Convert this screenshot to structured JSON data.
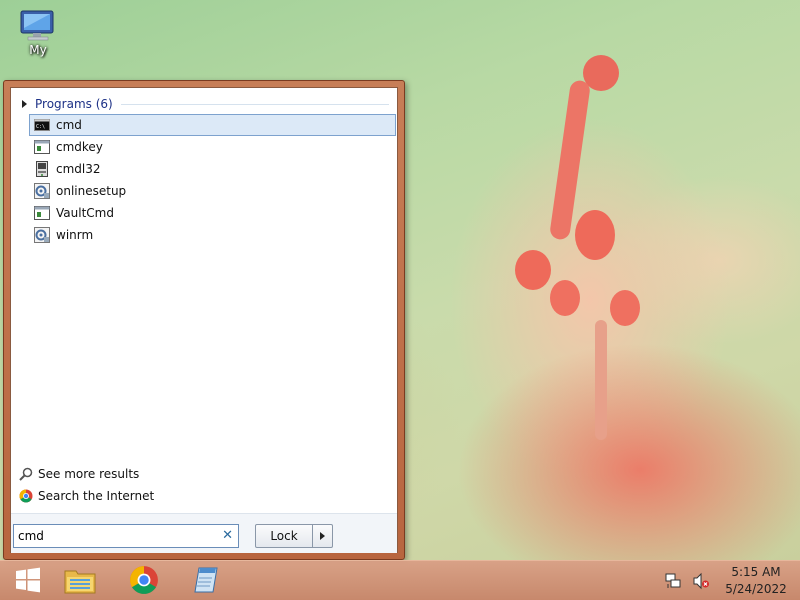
{
  "desktop": {
    "icons": [
      {
        "label": "My",
        "icon": "computer-icon"
      }
    ]
  },
  "start_menu": {
    "programs_header": "Programs (6)",
    "programs": [
      {
        "name": "cmd",
        "icon": "console-icon",
        "selected": true
      },
      {
        "name": "cmdkey",
        "icon": "window-app-icon",
        "selected": false
      },
      {
        "name": "cmdl32",
        "icon": "connection-manager-icon",
        "selected": false
      },
      {
        "name": "onlinesetup",
        "icon": "setup-gear-icon",
        "selected": false
      },
      {
        "name": "VaultCmd",
        "icon": "window-app-icon",
        "selected": false
      },
      {
        "name": "winrm",
        "icon": "setup-gear-icon",
        "selected": false
      }
    ],
    "see_more": "See more results",
    "search_internet": "Search the Internet",
    "search": {
      "value": "cmd",
      "clear_icon": "close-icon"
    },
    "lock_button": "Lock"
  },
  "taskbar": {
    "items": [
      {
        "name": "start-button",
        "icon": "windows-logo-icon"
      },
      {
        "name": "file-explorer",
        "icon": "folder-icon"
      },
      {
        "name": "chrome",
        "icon": "chrome-icon"
      },
      {
        "name": "notepad",
        "icon": "notepad-icon"
      }
    ],
    "tray": {
      "time": "5:15 AM",
      "date": "5/24/2022",
      "network_icon": "network-icon",
      "volume_icon": "volume-muted-icon"
    }
  },
  "colors": {
    "start_menu_frame": "#c77e57",
    "selection_bg": "#dce9f7",
    "selection_border": "#7da2ce",
    "header_text": "#1e3287"
  }
}
